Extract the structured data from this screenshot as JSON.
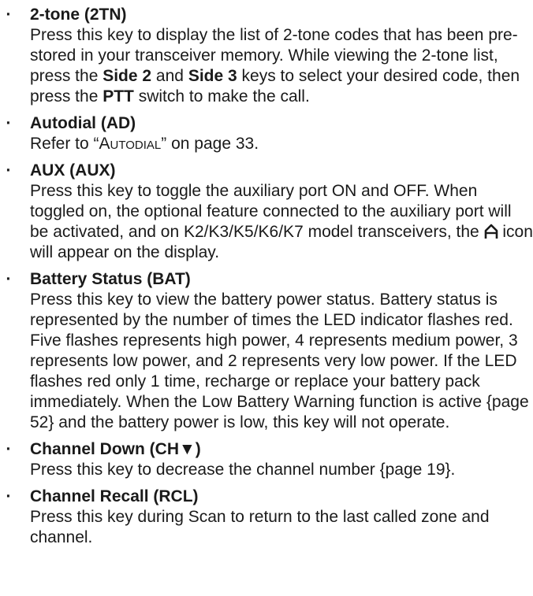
{
  "bullet_char": "·",
  "entries": [
    {
      "heading": "2-tone (2TN)",
      "body": {
        "p1": "Press this key to display the list of 2-tone codes that has been pre-stored in your transceiver memory. While viewing the 2-tone list, press the ",
        "k1": "Side 2",
        "p2": " and ",
        "k2": "Side 3",
        "p3": " keys to select your desired code, then press the ",
        "k3": "PTT",
        "p4": " switch to make the call."
      }
    },
    {
      "heading": "Autodial (AD)",
      "body": {
        "p1": "Refer to “",
        "ref": "Autodial",
        "p2": "” on page 33."
      }
    },
    {
      "heading": "AUX (AUX)",
      "body": {
        "p1": "Press this key to toggle the auxiliary port ON and OFF. When toggled on, the optional feature connected to the auxiliary port will be activated, and on K2/K3/K5/K6/K7 model transceivers, the ",
        "p2": " icon will appear on the display."
      }
    },
    {
      "heading": "Battery Status (BAT)",
      "body": "Press this key to view the battery power status. Battery status is represented by the number of times the LED indicator flashes red. Five flashes represents high power, 4 represents medium power, 3 represents low power, and 2 represents very low power. If the LED flashes red only 1 time, recharge or replace your battery pack immediately. When the Low Battery Warning function is active {page 52} and the battery power is low, this key will not operate."
    },
    {
      "heading": "Channel Down (CH▼)",
      "body": "Press this key to decrease the channel number {page 19}."
    },
    {
      "heading": "Channel Recall (RCL)",
      "body": "Press this key during Scan to return to the last called zone and channel."
    }
  ]
}
